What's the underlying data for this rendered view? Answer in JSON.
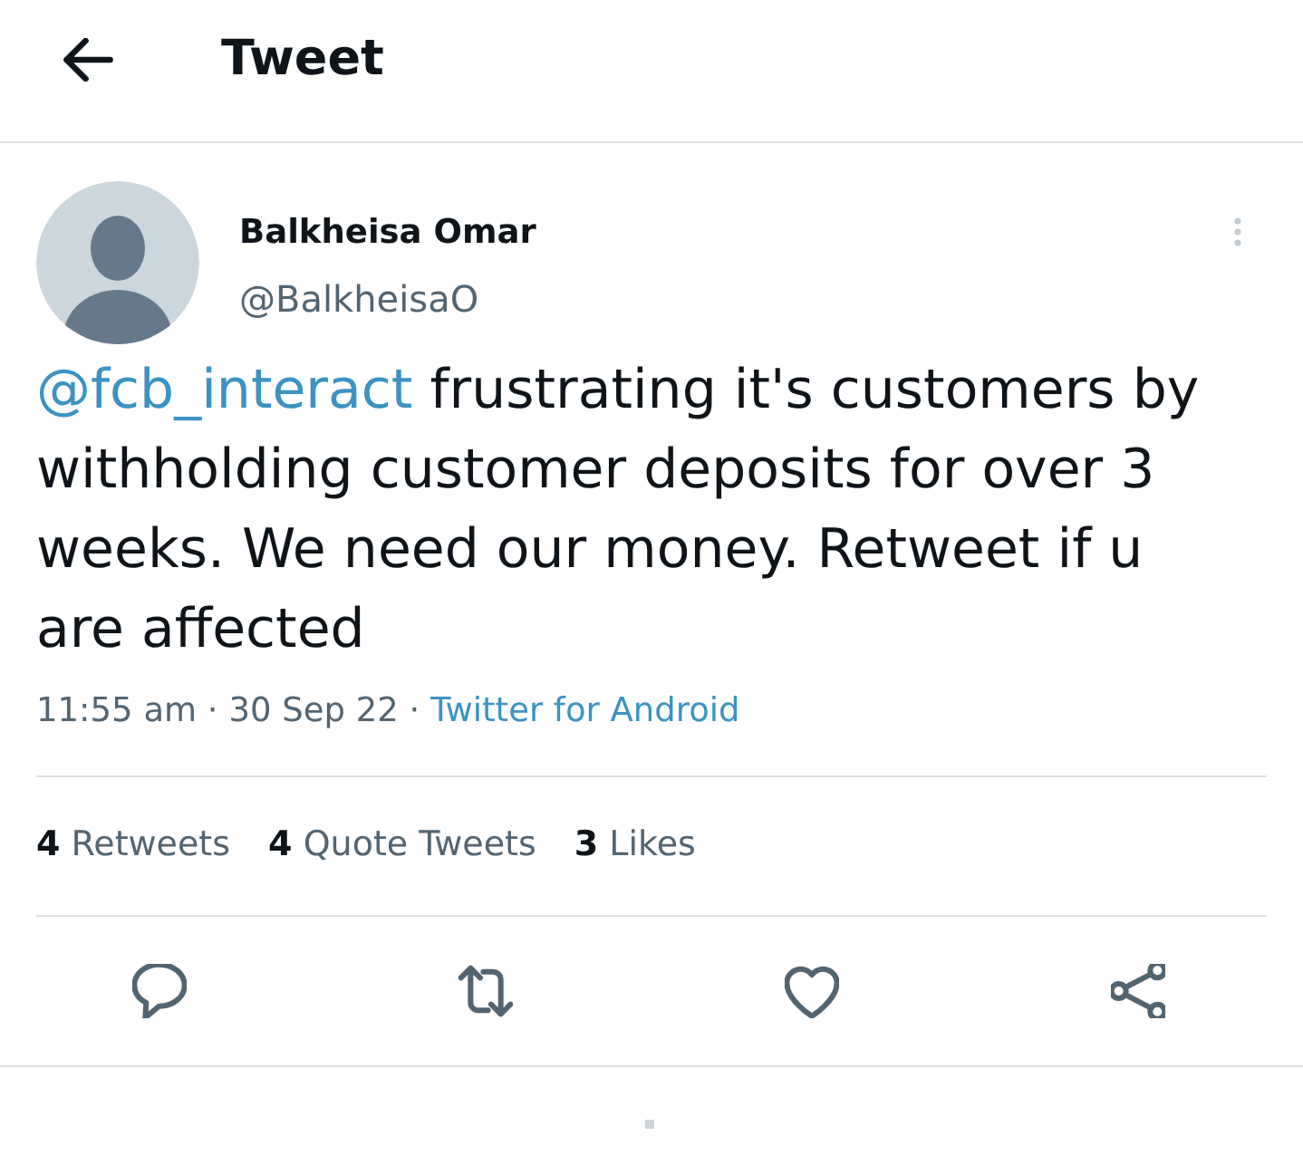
{
  "header": {
    "title": "Tweet"
  },
  "tweet": {
    "author": {
      "name": "Balkheisa Omar",
      "handle": "@BalkheisaO"
    },
    "text": [
      {
        "kind": "mention",
        "text": "@fcb_interact"
      },
      {
        "kind": "plain",
        "text": " frustrating it's customers by withholding customer deposits for over 3 weeks. We need our money. Retweet if u are affected"
      }
    ],
    "meta": [
      {
        "kind": "plain",
        "text": "11:55 am · 30 Sep 22 · "
      },
      {
        "kind": "link",
        "text": "Twitter for Android"
      }
    ],
    "stats": [
      {
        "count": "4",
        "label": "Retweets"
      },
      {
        "count": "4",
        "label": "Quote Tweets"
      },
      {
        "count": "3",
        "label": "Likes"
      }
    ]
  }
}
